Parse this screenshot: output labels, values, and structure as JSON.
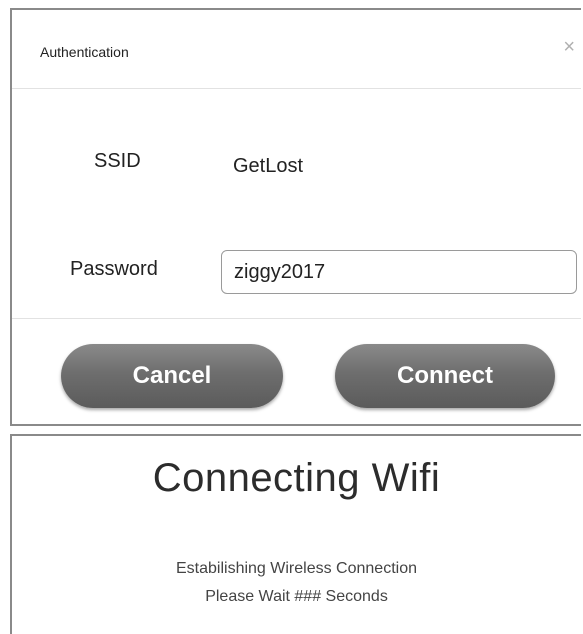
{
  "dialog": {
    "title": "Authentication",
    "close_glyph": "×",
    "ssid_label": "SSID",
    "ssid_value": "GetLost",
    "password_label": "Password",
    "password_value": "ziggy2017",
    "cancel_label": "Cancel",
    "connect_label": "Connect",
    "icons": [
      "close-icon"
    ]
  },
  "status": {
    "title": "Connecting Wifi",
    "line1": "Estabilishing Wireless Connection",
    "line2": "Please Wait ### Seconds"
  }
}
